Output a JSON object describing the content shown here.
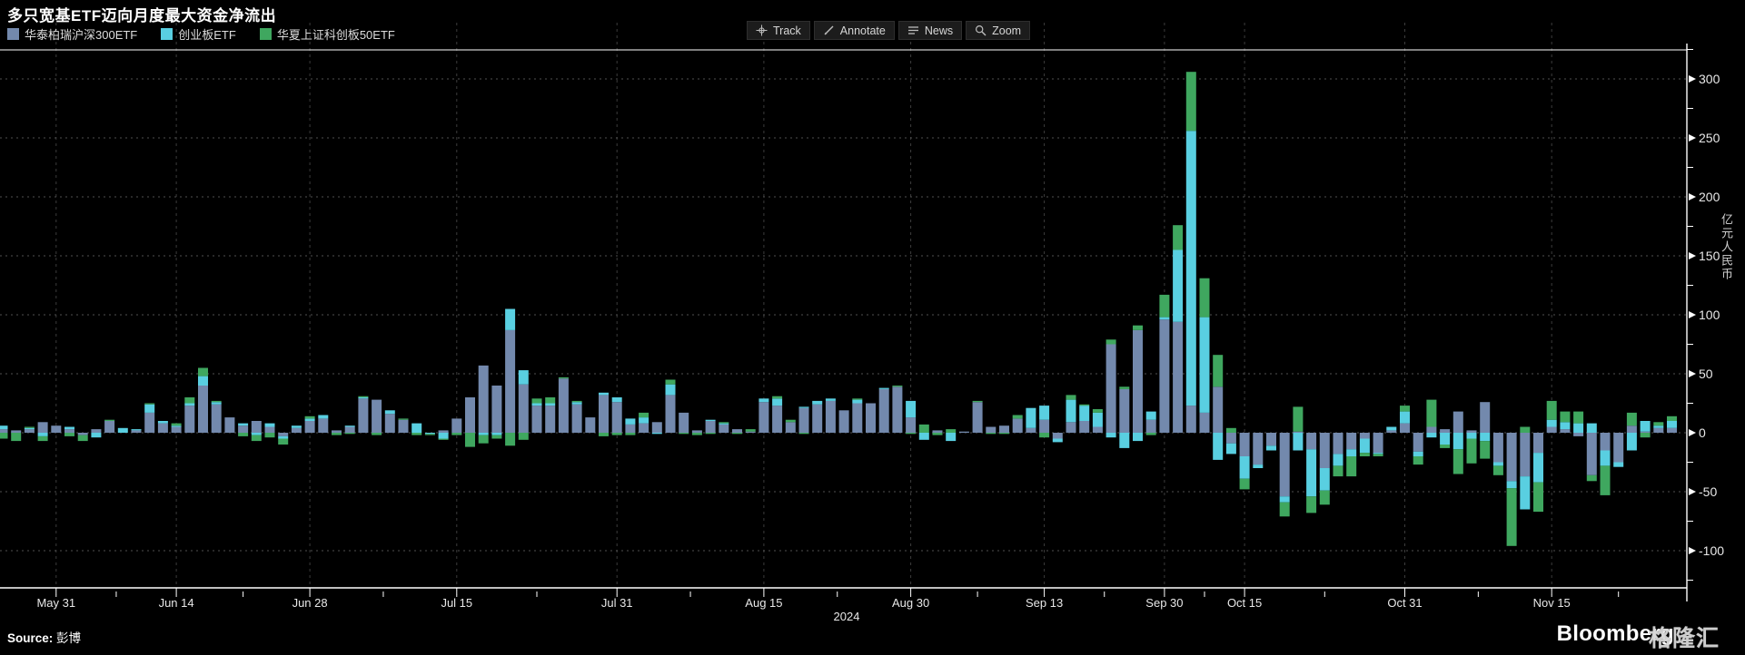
{
  "title": "多只宽基ETF迈向月度最大资金净流出",
  "legend": {
    "items": [
      {
        "label": "华泰柏瑞沪深300ETF",
        "color": "#7389ad"
      },
      {
        "label": "创业板ETF",
        "color": "#59cfe1"
      },
      {
        "label": "华夏上证科创板50ETF",
        "color": "#3fa75f"
      }
    ]
  },
  "toolbar": {
    "items": [
      {
        "label": "Track",
        "icon": "track-icon"
      },
      {
        "label": "Annotate",
        "icon": "annotate-icon"
      },
      {
        "label": "News",
        "icon": "news-icon"
      },
      {
        "label": "Zoom",
        "icon": "zoom-icon"
      }
    ]
  },
  "y_axis": {
    "unit": "亿元人民币",
    "ticks": [
      300,
      250,
      200,
      150,
      100,
      50,
      0,
      -50,
      -100
    ],
    "minor_step": 25
  },
  "x_axis": {
    "year": "2024",
    "labels": [
      {
        "label": "May 31",
        "bar": 4
      },
      {
        "label": "Jun 14",
        "bar": 13
      },
      {
        "label": "Jun 28",
        "bar": 23
      },
      {
        "label": "Jul 15",
        "bar": 34
      },
      {
        "label": "Jul 31",
        "bar": 46
      },
      {
        "label": "Aug 15",
        "bar": 57
      },
      {
        "label": "Aug 30",
        "bar": 68
      },
      {
        "label": "Sep 13",
        "bar": 78
      },
      {
        "label": "Sep 30",
        "bar": 87
      },
      {
        "label": "Oct 15",
        "bar": 93
      },
      {
        "label": "Oct 31",
        "bar": 105
      },
      {
        "label": "Nov 15",
        "bar": 116
      }
    ]
  },
  "footer": {
    "source_prefix": "Source:",
    "source": "彭博",
    "brand": "Bloomberg",
    "watermark": "格隆汇"
  },
  "colors": {
    "background": "#000000",
    "axis": "#ffffff",
    "grid_h": "#4f4f4f",
    "grid_v": "#3d3d3d",
    "text": "#e8e8e8"
  },
  "chart_data": {
    "type": "bar",
    "stacked": true,
    "title": "多只宽基ETF迈向月度最大资金净流出",
    "ylabel": "亿元人民币",
    "ylim": [
      -138,
      325
    ],
    "grid": true,
    "legend_position": "top-left",
    "series": [
      {
        "name": "华泰柏瑞沪深300ETF",
        "color": "#7389ad"
      },
      {
        "name": "创业板ETF",
        "color": "#59cfe1"
      },
      {
        "name": "华夏上证科创板50ETF",
        "color": "#3fa75f"
      }
    ],
    "bars": [
      [
        3,
        3,
        -5
      ],
      [
        2,
        0,
        -7
      ],
      [
        3,
        1,
        1
      ],
      [
        9,
        -3,
        -4
      ],
      [
        6,
        0,
        0
      ],
      [
        3,
        2,
        -3
      ],
      [
        -2,
        0,
        -5
      ],
      [
        3,
        -4,
        0
      ],
      [
        10,
        0,
        1
      ],
      [
        0,
        4,
        0
      ],
      [
        2,
        1,
        0
      ],
      [
        17,
        7,
        1
      ],
      [
        8,
        2,
        0
      ],
      [
        5,
        1,
        2
      ],
      [
        23,
        2,
        5
      ],
      [
        40,
        8,
        7
      ],
      [
        24,
        2,
        1
      ],
      [
        13,
        0,
        0
      ],
      [
        6,
        2,
        -3
      ],
      [
        10,
        -2,
        -5
      ],
      [
        5,
        3,
        -4
      ],
      [
        -3,
        -2,
        -5
      ],
      [
        4,
        2,
        0
      ],
      [
        10,
        2,
        2
      ],
      [
        12,
        3,
        0
      ],
      [
        2,
        0,
        -2
      ],
      [
        5,
        1,
        -1
      ],
      [
        29,
        1,
        1
      ],
      [
        28,
        0,
        -2
      ],
      [
        16,
        3,
        0
      ],
      [
        11,
        0,
        1
      ],
      [
        0,
        8,
        -2
      ],
      [
        0,
        -1,
        -1
      ],
      [
        2,
        -5,
        -1
      ],
      [
        12,
        0,
        -2
      ],
      [
        30,
        0,
        -12
      ],
      [
        57,
        -2,
        -7
      ],
      [
        40,
        -2,
        -3
      ],
      [
        87,
        18,
        -11
      ],
      [
        41,
        12,
        -6
      ],
      [
        23,
        2,
        4
      ],
      [
        23,
        2,
        5
      ],
      [
        46,
        0,
        1
      ],
      [
        24,
        2,
        1
      ],
      [
        13,
        0,
        0
      ],
      [
        32,
        2,
        -3
      ],
      [
        26,
        4,
        -2
      ],
      [
        7,
        5,
        -2
      ],
      [
        8,
        5,
        4
      ],
      [
        9,
        -1,
        0
      ],
      [
        32,
        9,
        4
      ],
      [
        17,
        0,
        -1
      ],
      [
        2,
        0,
        -2
      ],
      [
        10,
        1,
        -1
      ],
      [
        7,
        1,
        1
      ],
      [
        3,
        0,
        -1
      ],
      [
        1,
        0,
        2
      ],
      [
        26,
        3,
        0
      ],
      [
        23,
        6,
        2
      ],
      [
        9,
        0,
        2
      ],
      [
        21,
        1,
        -1
      ],
      [
        24,
        3,
        0
      ],
      [
        27,
        2,
        0
      ],
      [
        19,
        0,
        0
      ],
      [
        25,
        3,
        1
      ],
      [
        25,
        0,
        0
      ],
      [
        37,
        1,
        0
      ],
      [
        39,
        0,
        1
      ],
      [
        13,
        14,
        -1
      ],
      [
        0,
        -6,
        7
      ],
      [
        2,
        0,
        -2
      ],
      [
        0,
        -7,
        3
      ],
      [
        1,
        0,
        0
      ],
      [
        26,
        0,
        1
      ],
      [
        5,
        0,
        -1
      ],
      [
        6,
        0,
        -1
      ],
      [
        12,
        0,
        3
      ],
      [
        4,
        17,
        0
      ],
      [
        11,
        12,
        -4
      ],
      [
        -5,
        -3,
        0
      ],
      [
        9,
        19,
        4
      ],
      [
        10,
        13,
        1
      ],
      [
        5,
        12,
        3
      ],
      [
        75,
        -4,
        4
      ],
      [
        37,
        -13,
        2
      ],
      [
        87,
        -7,
        4
      ],
      [
        11,
        7,
        -2
      ],
      [
        96,
        2,
        19
      ],
      [
        94,
        61,
        21
      ],
      [
        23,
        233,
        50
      ],
      [
        17,
        81,
        33
      ],
      [
        39,
        -23,
        27
      ],
      [
        -9,
        -9,
        4
      ],
      [
        -20,
        -19,
        -9
      ],
      [
        -27,
        -3,
        0
      ],
      [
        -11,
        -4,
        0
      ],
      [
        -54,
        -5,
        -12
      ],
      [
        1,
        -15,
        21
      ],
      [
        -14,
        -40,
        -14
      ],
      [
        -30,
        -19,
        -12
      ],
      [
        -18,
        -10,
        -9
      ],
      [
        -14,
        -6,
        -17
      ],
      [
        -5,
        -12,
        -3
      ],
      [
        -17,
        -1,
        -2
      ],
      [
        2,
        3,
        0
      ],
      [
        8,
        10,
        5
      ],
      [
        -16,
        -4,
        -7
      ],
      [
        5,
        -4,
        23
      ],
      [
        3,
        -10,
        -3
      ],
      [
        18,
        -14,
        -21
      ],
      [
        2,
        -5,
        -21
      ],
      [
        26,
        -7,
        -15
      ],
      [
        -25,
        -3,
        -8
      ],
      [
        -41,
        -6,
        -49
      ],
      [
        -37,
        -28,
        5
      ],
      [
        -17,
        -25,
        -25
      ],
      [
        5,
        6,
        16
      ],
      [
        3,
        6,
        9
      ],
      [
        -3,
        8,
        10
      ],
      [
        -36,
        8,
        -5
      ],
      [
        -15,
        -13,
        -25
      ],
      [
        -25,
        -4,
        0
      ],
      [
        6,
        -15,
        11
      ],
      [
        1,
        9,
        -4
      ],
      [
        4,
        2,
        3
      ],
      [
        4,
        6,
        4
      ]
    ]
  }
}
